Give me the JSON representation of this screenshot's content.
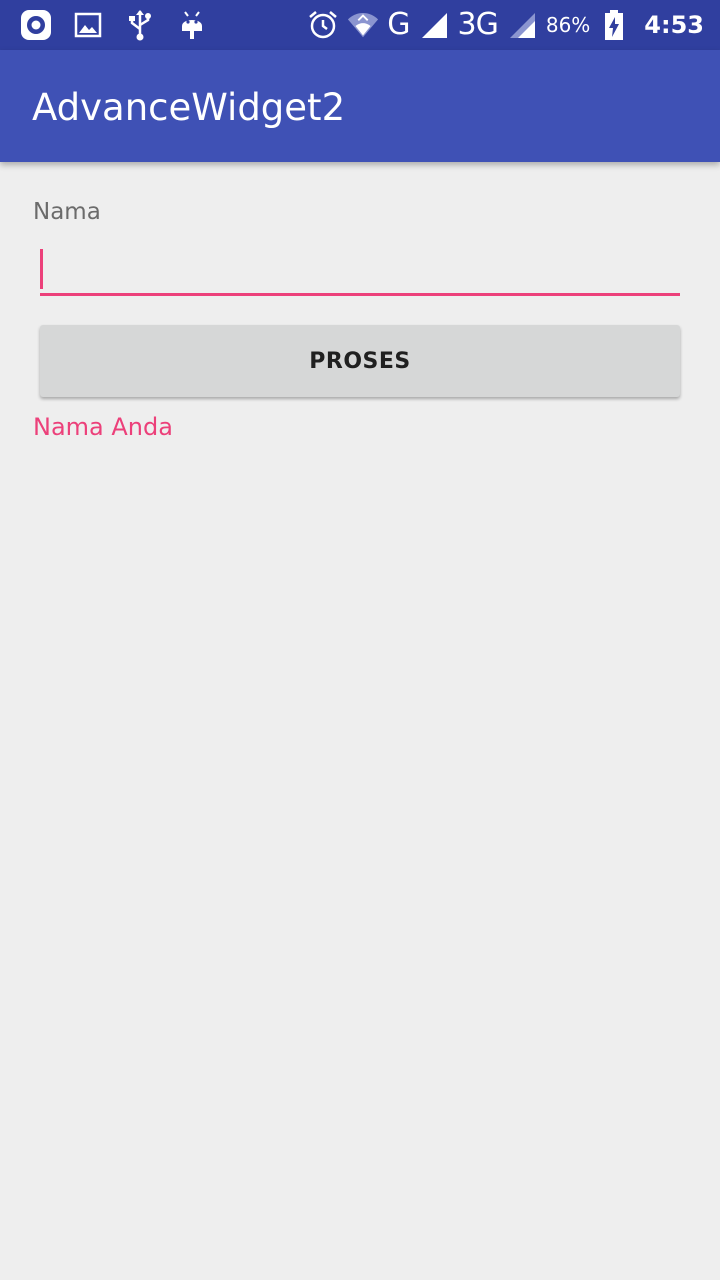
{
  "status_bar": {
    "left_icons": [
      "screen-record-icon",
      "image-icon",
      "usb-icon",
      "android-debug-icon"
    ],
    "right_icons": [
      "alarm-icon",
      "wifi-icon",
      "signal-icon"
    ],
    "network_1": "G",
    "network_2": "3G",
    "battery_percent": "86%",
    "time": "4:53",
    "background_color": "#303f9f"
  },
  "app_bar": {
    "title": "AdvanceWidget2",
    "background_color": "#3f51b5"
  },
  "form": {
    "label": "Nama",
    "input_value": "",
    "accent_color": "#ec407a",
    "button_label": "PROSES",
    "result_text": "Nama Anda"
  }
}
